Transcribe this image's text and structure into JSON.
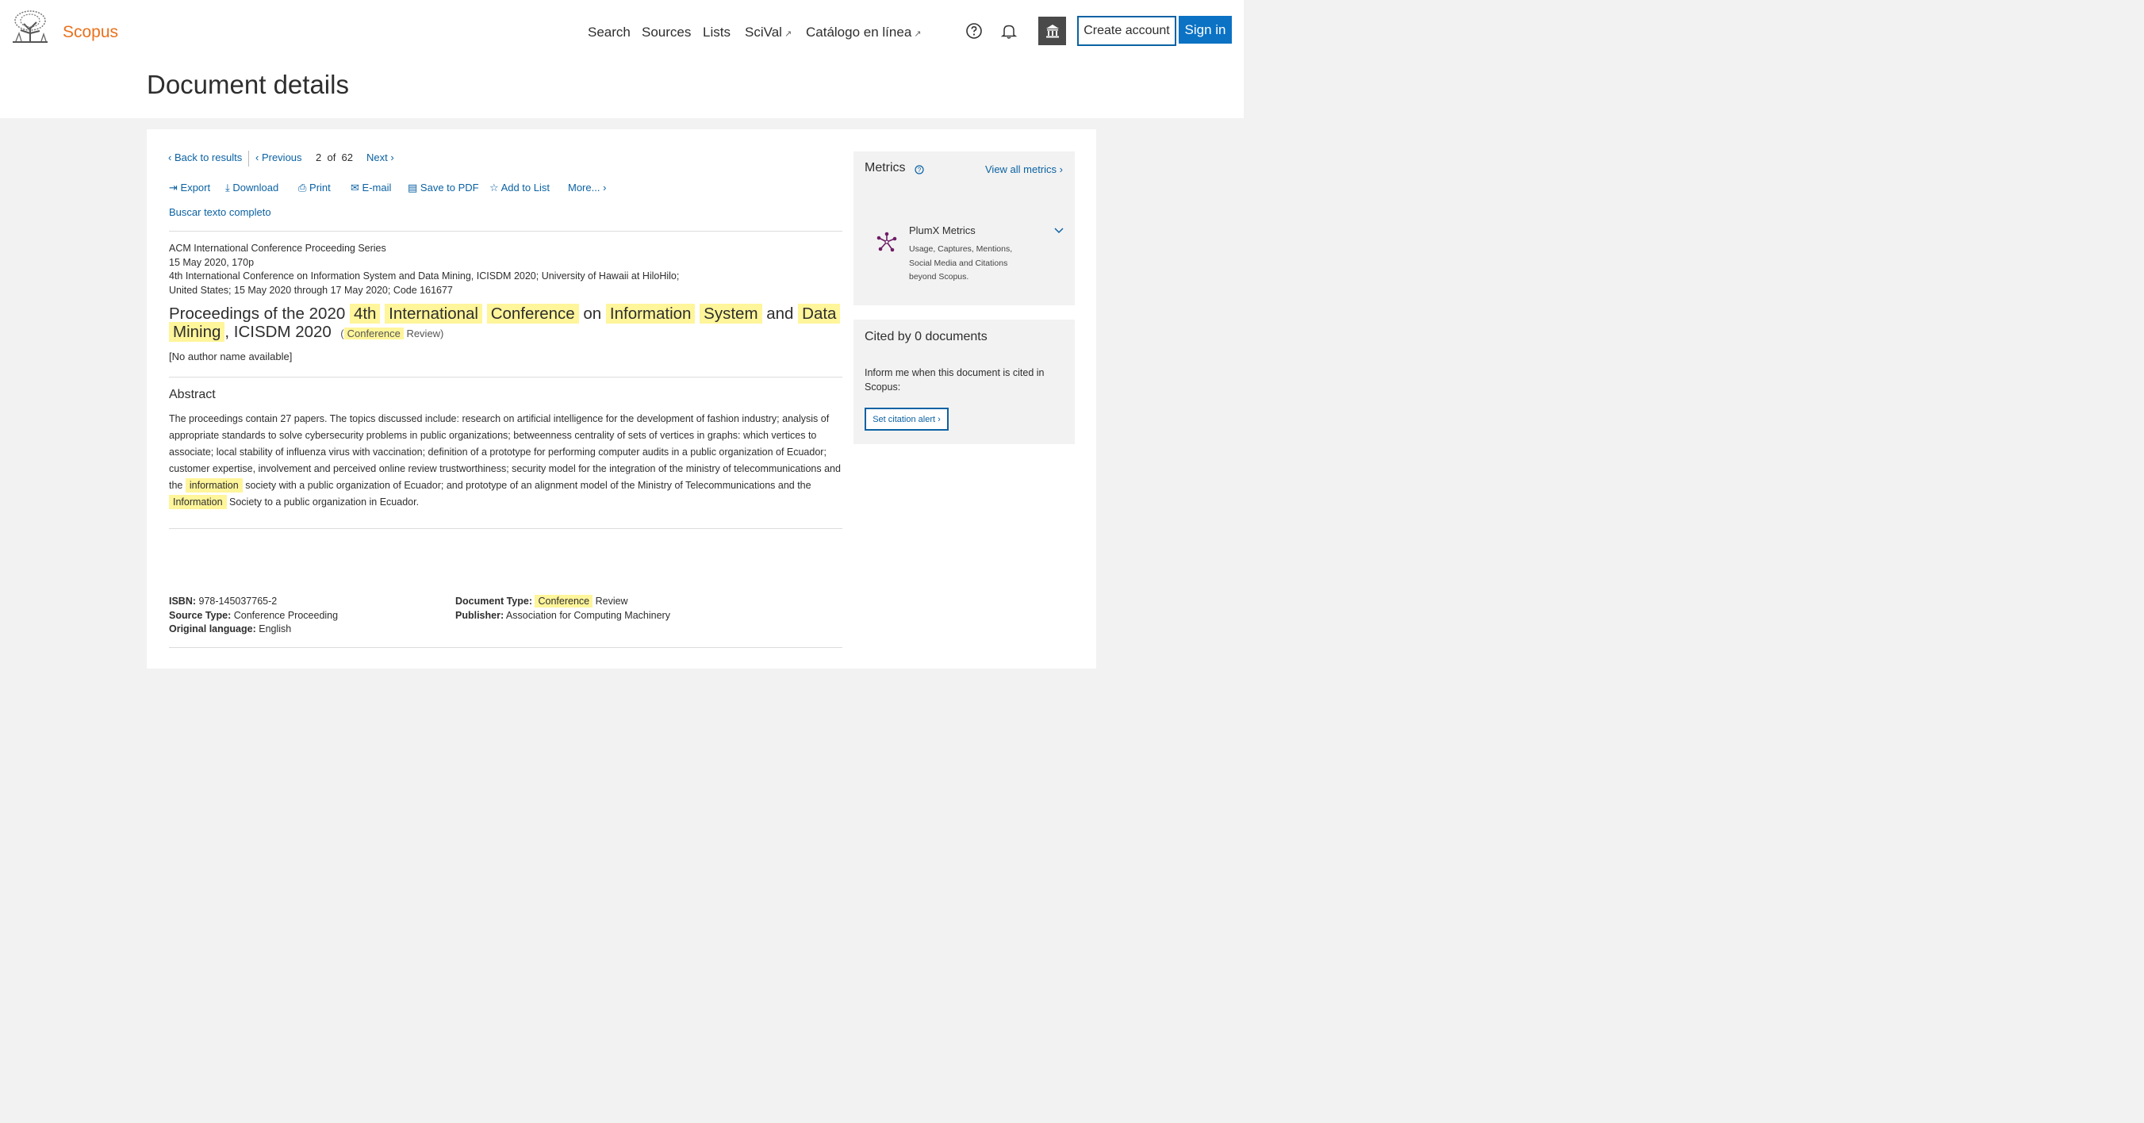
{
  "header": {
    "brand": "Scopus",
    "nav": [
      {
        "label": "Search"
      },
      {
        "label": "Sources"
      },
      {
        "label": "Lists"
      },
      {
        "label": "SciVal",
        "external": true
      },
      {
        "label": "Catálogo en línea",
        "external": true
      }
    ],
    "create_account": "Create account",
    "sign_in": "Sign in"
  },
  "page_title": "Document details",
  "toolbar": {
    "back": "Back to results",
    "previous": "Previous",
    "position": "2",
    "of": "of",
    "total": "62",
    "next": "Next",
    "actions": [
      "Export",
      "Download",
      "Print",
      "E-mail",
      "Save to PDF",
      "Add to List",
      "More..."
    ],
    "full_text": "Buscar texto completo"
  },
  "document": {
    "series": "ACM International Conference Proceeding Series",
    "date_pages": "15 May 2020, 170p",
    "conference_line1": "4th International Conference on Information System and Data Mining, ICISDM 2020; University of Hawaii at HiloHilo;",
    "conference_line2": "United States; 15 May 2020 through 17 May 2020; Code 161677",
    "title_parts": {
      "t1": "Proceedings of the 2020",
      "t2": "4th",
      "t3": "International",
      "t4": "Conference",
      "t5": "on",
      "t6": "Information",
      "t7": "System",
      "t8": "and",
      "t9": "Data",
      "t10": "Mining",
      "t11": ", ICISDM 2020"
    },
    "doc_type_conf": "Conference",
    "doc_type_rest": "Review)",
    "author": "[No author name available]",
    "abstract_heading": "Abstract",
    "abstract": {
      "a1": "The proceedings contain 27 papers. The topics discussed include: research on artificial intelligence for the development of fashion industry; analysis of appropriate standards to solve cybersecurity problems in public organizations; betweenness centrality of sets of vertices in graphs: which vertices to associate; local stability of influenza virus with vaccination; definition of a prototype for performing computer audits in a public organization of Ecuador; customer expertise, involvement and perceived online review trustworthiness; security model for the integration of the ministry of telecommunications and the",
      "h1": "information",
      "a2": "society with a public organization of Ecuador; and prototype of an alignment model of the Ministry of Telecommunications and the",
      "h2": "Information",
      "a3": "Society to a public organization in Ecuador."
    },
    "isbn_label": "ISBN:",
    "isbn": "978-145037765-2",
    "source_type_label": "Source Type:",
    "source_type": "Conference Proceeding",
    "language_label": "Original language:",
    "language": "English",
    "doctype_label": "Document Type:",
    "doctype_conf": "Conference",
    "doctype_rest": "Review",
    "publisher_label": "Publisher:",
    "publisher": "Association for Computing Machinery"
  },
  "metrics": {
    "heading": "Metrics",
    "view_all": "View all metrics",
    "plumx_title": "PlumX Metrics",
    "plumx_desc1": "Usage, Captures, Mentions,",
    "plumx_desc2": "Social Media and Citations",
    "plumx_desc3": "beyond Scopus."
  },
  "cited": {
    "heading": "Cited by 0 documents",
    "inform": "Inform me when this document is cited in Scopus:",
    "alert_button": "Set citation alert"
  },
  "colors": {
    "brand_orange": "#e9711c",
    "link_blue": "#0b62a3",
    "highlight": "#fff59a",
    "plumx_purple": "#6e1e66"
  }
}
